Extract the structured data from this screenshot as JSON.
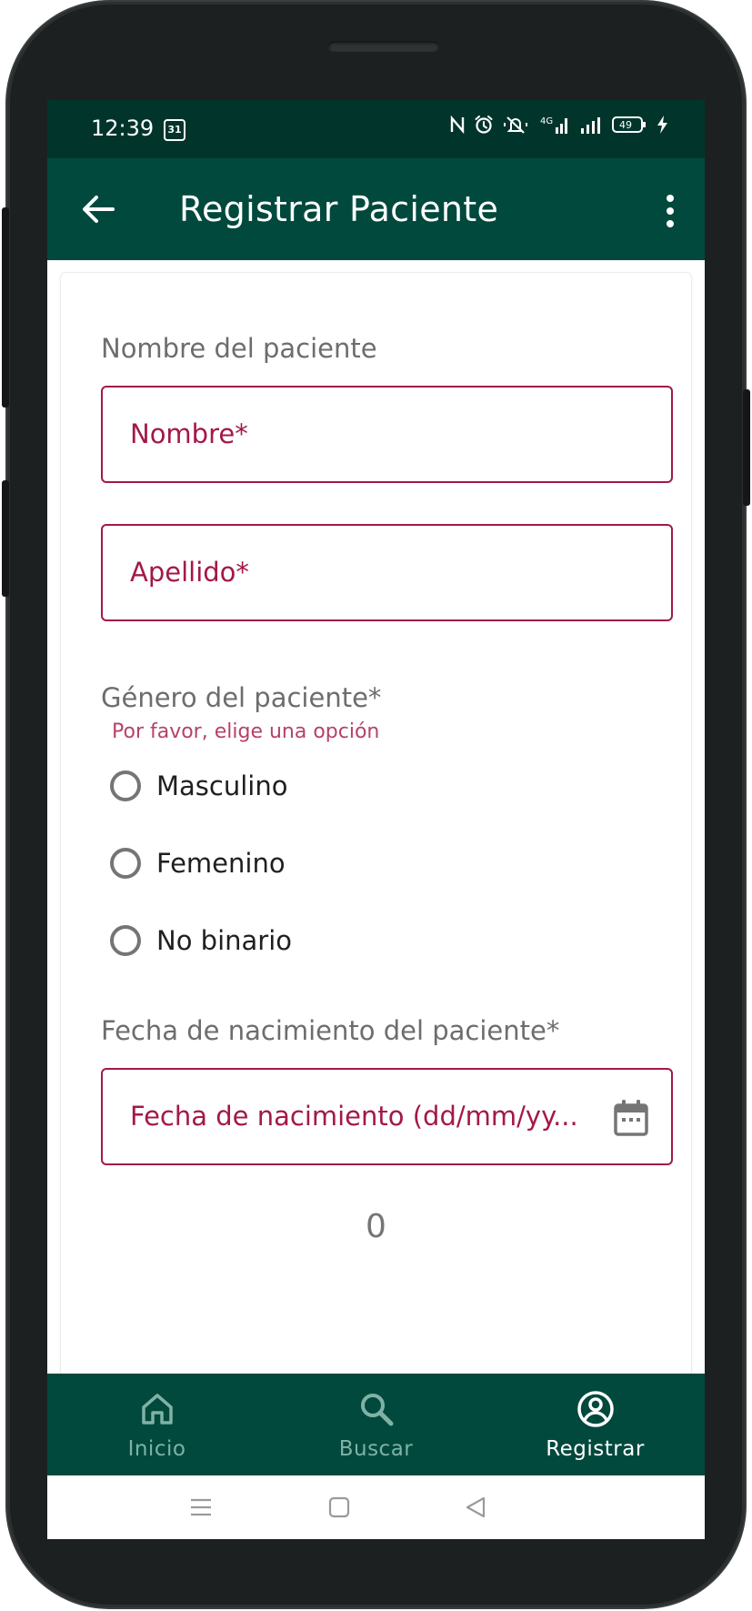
{
  "status_bar": {
    "time": "12:39",
    "calendar_badge": "31",
    "battery": "49",
    "icons": [
      "nfc-icon",
      "alarm-icon",
      "silent-icon",
      "signal-4g-icon",
      "signal-icon",
      "battery-icon",
      "charging-icon"
    ]
  },
  "app_bar": {
    "title": "Registrar Paciente",
    "back_icon": "arrow-left-icon",
    "menu_icon": "more-vert-icon"
  },
  "form": {
    "name_section_label": "Nombre del paciente",
    "first_name_placeholder": "Nombre*",
    "last_name_placeholder": "Apellido*",
    "gender_label": "Género del paciente*",
    "gender_error": "Por favor, elige una opción",
    "gender_options": [
      "Masculino",
      "Femenino",
      "No binario"
    ],
    "birthdate_label": "Fecha de nacimiento del paciente*",
    "birthdate_placeholder": "Fecha de nacimiento (dd/mm/yy...",
    "counter": "0"
  },
  "bottom_nav": {
    "items": [
      {
        "label": "Inicio",
        "icon": "home-icon"
      },
      {
        "label": "Buscar",
        "icon": "search-icon"
      },
      {
        "label": "Registrar",
        "icon": "account-circle-icon"
      }
    ],
    "active": "Registrar"
  },
  "colors": {
    "primary_dark": "#01352c",
    "primary": "#01493d",
    "error": "#a3184a"
  }
}
